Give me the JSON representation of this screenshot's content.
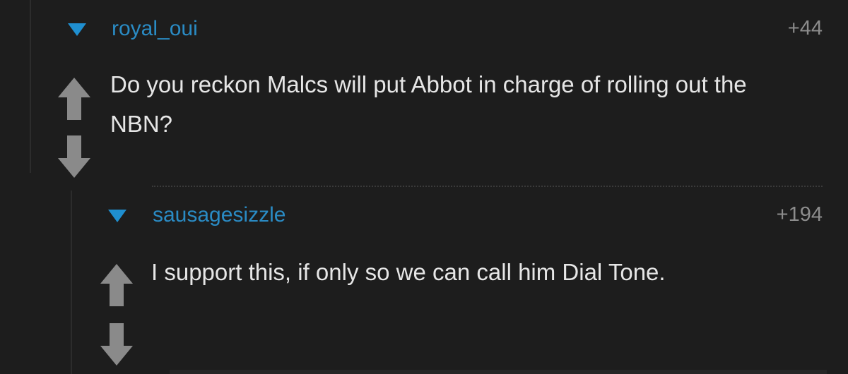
{
  "comments": [
    {
      "username": "royal_oui",
      "score": "+44",
      "body": "Do you reckon Malcs will put Abbot in charge of rolling out the NBN?",
      "collapse_icon": "triangle-down-icon",
      "upvote_icon": "arrow-up-icon",
      "downvote_icon": "arrow-down-icon"
    },
    {
      "username": "sausagesizzle",
      "score": "+194",
      "body": "I support this, if only so we can call him Dial Tone.",
      "collapse_icon": "triangle-down-icon",
      "upvote_icon": "arrow-up-icon",
      "downvote_icon": "arrow-down-icon"
    }
  ],
  "colors": {
    "background": "#1d1d1d",
    "username": "#2a8bc4",
    "score": "#8c8c8c",
    "body_text": "#e6e6e6",
    "vote_arrow": "#8a8a8a",
    "collapse_triangle": "#1f8fd0"
  }
}
